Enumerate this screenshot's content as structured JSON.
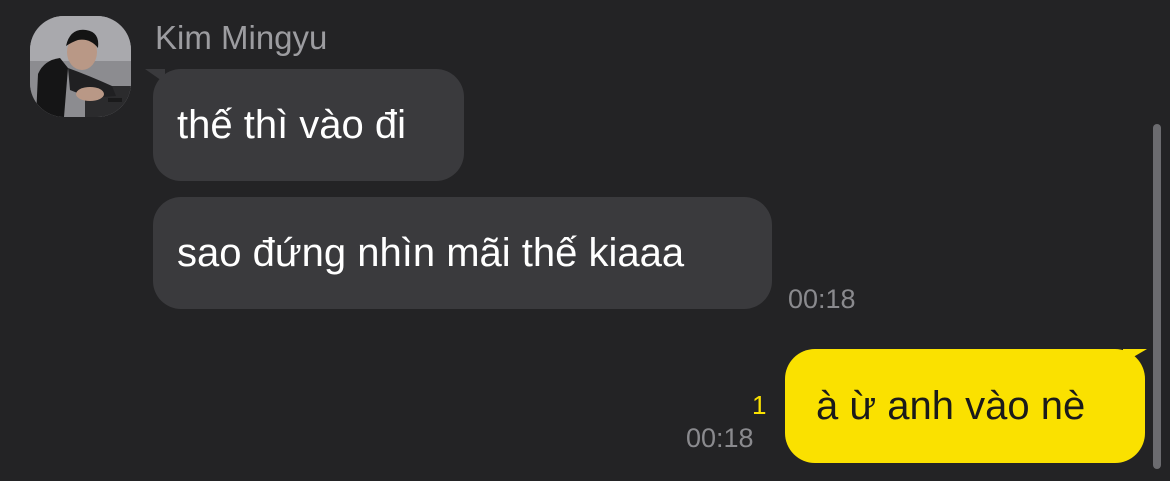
{
  "sender": {
    "name": "Kim Mingyu",
    "avatar": "profile-photo"
  },
  "messages": [
    {
      "direction": "incoming",
      "text": "thế thì vào đi"
    },
    {
      "direction": "incoming",
      "text": "sao đứng nhìn mãi thế kiaaa",
      "time": "00:18"
    },
    {
      "direction": "outgoing",
      "text": "à ừ anh vào nè",
      "time": "00:18",
      "unread_count": "1"
    }
  ],
  "colors": {
    "background": "#232325",
    "incoming_bubble": "#3a3a3d",
    "outgoing_bubble": "#fae100",
    "unread_badge": "#fae100"
  }
}
